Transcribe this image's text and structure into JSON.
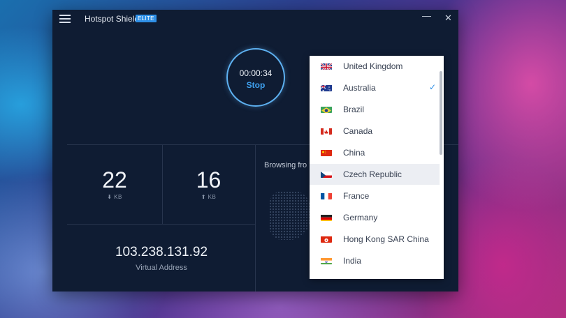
{
  "window": {
    "app_title": "Hotspot Shield",
    "badge": "ELITE",
    "minimize": "—",
    "close": "✕"
  },
  "connection": {
    "timer": "00:00:34",
    "stop_label": "Stop"
  },
  "stats": {
    "download_value": "22",
    "download_unit": "⬇ KB",
    "upload_value": "16",
    "upload_unit": "⬆ KB",
    "ip_address": "103.238.131.92",
    "ip_label": "Virtual Address",
    "browsing_label": "Browsing fro"
  },
  "countries": [
    {
      "name": "United Kingdom",
      "flag": "uk-flag-icon"
    },
    {
      "name": "Australia",
      "flag": "australia-flag-icon",
      "checked": true
    },
    {
      "name": "Brazil",
      "flag": "brazil-flag-icon"
    },
    {
      "name": "Canada",
      "flag": "canada-flag-icon"
    },
    {
      "name": "China",
      "flag": "china-flag-icon"
    },
    {
      "name": "Czech Republic",
      "flag": "czech-flag-icon",
      "highlighted": true
    },
    {
      "name": "France",
      "flag": "france-flag-icon"
    },
    {
      "name": "Germany",
      "flag": "germany-flag-icon"
    },
    {
      "name": "Hong Kong SAR China",
      "flag": "hong-kong-flag-icon"
    },
    {
      "name": "India",
      "flag": "india-flag-icon"
    }
  ],
  "checkmark": "✓",
  "colors": {
    "accent": "#2e8fe6",
    "window_bg": "#0f1c33",
    "ring": "#5db0f0"
  }
}
